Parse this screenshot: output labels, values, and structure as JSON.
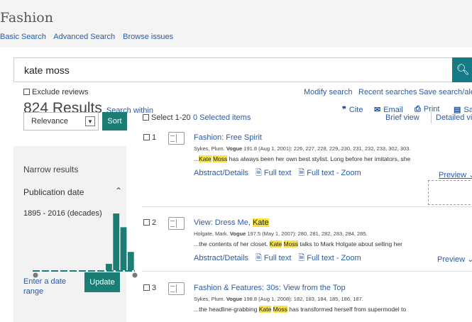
{
  "header": {
    "title": "Fashion",
    "nav": [
      "Basic Search",
      "Advanced Search",
      "Browse issues"
    ]
  },
  "search": {
    "query": "kate moss",
    "button_icon": "search-icon"
  },
  "exclude_reviews": "Exclude reviews",
  "top_links": [
    "Modify search",
    "Recent searches",
    "Save search/alert"
  ],
  "results": {
    "count_label": "824 Results",
    "search_within": "Search within"
  },
  "tools": {
    "cite": "Cite",
    "email": "Email",
    "print": "Print",
    "save": "Sa",
    "cite_icon": "quote-icon",
    "email_icon": "envelope-icon",
    "print_icon": "printer-icon",
    "save_icon": "save-icon"
  },
  "sort": {
    "selected": "Relevance",
    "button": "Sort"
  },
  "facets": {
    "narrow": "Narrow results",
    "publication_date": "Publication date",
    "range_label": "1895 - 2016 (decades)",
    "enter_date": "Enter a date range",
    "update": "Update"
  },
  "histogram": {
    "bars": [
      0,
      0,
      0,
      0,
      0,
      0,
      0,
      0,
      0,
      0,
      0.07,
      0.62,
      0.47,
      0.2
    ],
    "color": "#1b7d74"
  },
  "list_controls": {
    "select": "Select 1-20",
    "selected_items": "0 Selected items",
    "brief_view": "Brief view",
    "detailed_view": "Detailed vi"
  },
  "records": [
    {
      "num": "1",
      "title": "Fashion: Free Spirit",
      "cite_pre": "Sykes, Plum. ",
      "cite_bold": "Vogue",
      "cite_post": " 191.8  (Aug 1, 2001): 226, 227, 228, 229, 230, 231, 232, 233, 302, 303.",
      "snippet_pre": "...",
      "hl1": "Kate",
      "hl2": "Moss",
      "snippet_post": " has always been her own best stylist. Long before her imitators, she",
      "abstract": "Abstract/Details",
      "fulltext": "Full text",
      "fulltext_zoom": "Full text - Zoom",
      "preview": "Preview"
    },
    {
      "num": "2",
      "title_pre": "View: Dress Me, ",
      "title_hl": "Kate",
      "cite_pre": "Holgate, Mark. ",
      "cite_bold": "Vogue",
      "cite_post": " 197.5  (May 1, 2007): 280, 281, 282, 283, 284, 285.",
      "snippet_pre": "...the contents of her closet. ",
      "hl1": "Kate",
      "hl2": "Moss",
      "snippet_post": " talks to Mark Holgate about selling her",
      "abstract": "Abstract/Details",
      "fulltext": "Full text",
      "fulltext_zoom": "Full text - Zoom",
      "preview": "Preview"
    },
    {
      "num": "3",
      "title": "Fashion & Features: 30s: View from the Top",
      "cite_pre": "Sykes, Plum. ",
      "cite_bold": "Vogue",
      "cite_post": " 198.8  (Aug 1, 2008): 182, 183, 184, 185, 186, 187.",
      "snippet_pre": "...the headline-grabbing ",
      "hl1": "Kate",
      "hl2": "Moss",
      "snippet_post": " has transformed herself from supermodel to",
      "abstract": "Abstract/Details",
      "fulltext": "Full text",
      "fulltext_zoom": "Full text - Zoom",
      "preview": "Preview"
    }
  ]
}
